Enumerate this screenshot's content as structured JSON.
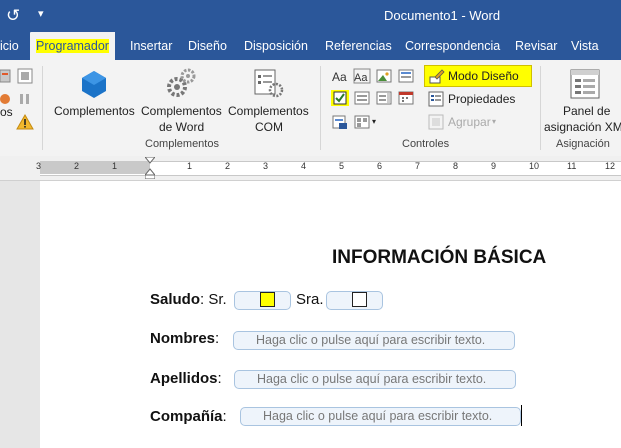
{
  "titlebar": {
    "title": "Documento1  -  Word",
    "undo_icon": "undo-icon",
    "qat_icon": "customize-qat-icon"
  },
  "menu": {
    "tabs": [
      {
        "label": "icio"
      },
      {
        "label": "Programador",
        "active": true
      },
      {
        "label": "Insertar"
      },
      {
        "label": "Diseño"
      },
      {
        "label": "Disposición"
      },
      {
        "label": "Referencias"
      },
      {
        "label": "Correspondencia"
      },
      {
        "label": "Revisar"
      },
      {
        "label": "Vista"
      }
    ]
  },
  "ribbon": {
    "left_partial": {
      "label": "os"
    },
    "complementos": {
      "group_label": "Complementos",
      "btn_complementos": "Complementos",
      "btn_word_l1": "Complementos",
      "btn_word_l2": "de Word",
      "btn_com_l1": "Complementos",
      "btn_com_l2": "COM"
    },
    "controles": {
      "group_label": "Controles",
      "modo_diseno": "Modo Diseño",
      "propiedades": "Propiedades",
      "agrupar": "Agrupar"
    },
    "asignacion": {
      "group_label": "Asignación",
      "btn_l1": "Panel de",
      "btn_l2": "asignación XM"
    }
  },
  "ruler": {
    "numbers": [
      "3",
      "2",
      "1",
      "1",
      "2",
      "3",
      "4",
      "5",
      "6",
      "7",
      "8",
      "9",
      "10",
      "11",
      "12"
    ]
  },
  "document": {
    "heading": "INFORMACIÓN BÁSICA",
    "saludo_label": "Saludo",
    "saludo_colon": ": Sr.",
    "sra": "Sra.",
    "nombres_label": "Nombres",
    "apellidos_label": "Apellidos",
    "compania_label": "Compañía",
    "colon": ":",
    "placeholder": "Haga clic o pulse aquí para escribir texto."
  },
  "colors": {
    "accent": "#2b579a",
    "highlight": "#ffff00"
  }
}
